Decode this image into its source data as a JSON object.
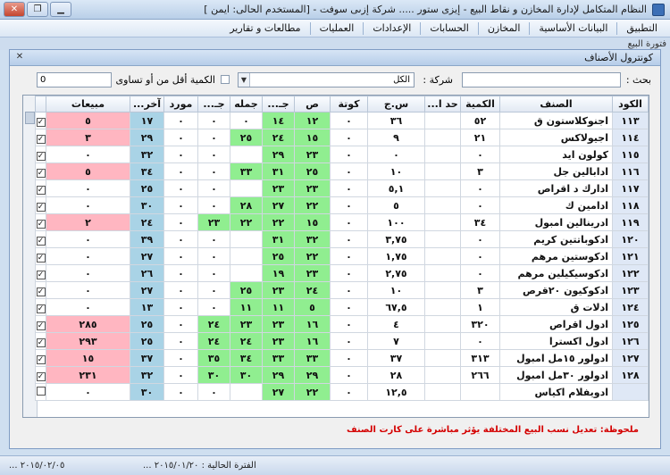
{
  "window": {
    "title": "النظام المتكامل لإدارة المخازن و نقاط البيع - إيزى ستور ..... شركة إزىى سوفت - [المستخدم الحالى: ايمن ]",
    "minimize": "▁",
    "maximize": "❐",
    "close": "✕"
  },
  "menu": [
    "التطبيق",
    "البيانات الأساسية",
    "المخازن",
    "الحسابات",
    "الإعدادات",
    "العمليات",
    "مطالعات و تقارير"
  ],
  "shortcut_strip": "فتورة البيع",
  "child_window": {
    "title": "كونترول الأصناف",
    "close": "✕"
  },
  "filter": {
    "search_label": "بحث :",
    "search_value": "",
    "company_label": "شركة :",
    "company_value": "الكل",
    "qty_label": "الكمية أقل من أو تساوى",
    "qty_value": "0"
  },
  "table": {
    "headers": [
      "الكود",
      "الصنف",
      "الكمية",
      "حد ا...",
      "س.ج",
      "كوتة",
      "ص",
      "جـ...",
      "جمله",
      "جـ...",
      "مورد",
      "آخر...",
      "مبيعات",
      ""
    ],
    "rows": [
      {
        "code": "١١٣",
        "name": "اجنوكلاستون ق",
        "qty": "٥٢",
        "limit": "",
        "price": "٣٦",
        "quota": "٠",
        "s": "١٢",
        "j1": "١٤",
        "bulk": "٠",
        "j2": "٠",
        "supplier": "٠",
        "last": "١٧",
        "sales": "٥",
        "sales_pink": true,
        "checked": true
      },
      {
        "code": "١١٤",
        "name": "اجيولاكس",
        "qty": "٢١",
        "limit": "",
        "price": "٩",
        "quota": "٠",
        "s": "١٥",
        "j1": "٢٤",
        "bulk": "٢٥",
        "j2": "٠",
        "supplier": "٠",
        "last": "٢٩",
        "sales": "٣",
        "sales_pink": true,
        "checked": true
      },
      {
        "code": "١١٥",
        "name": "كولون ايد",
        "qty": "٠",
        "limit": "",
        "price": "٠",
        "quota": "٠",
        "s": "٢٣",
        "j1": "٢٩",
        "bulk": "",
        "j2": "٠",
        "supplier": "٠",
        "last": "٣٢",
        "sales": "٠",
        "sales_pink": false,
        "checked": true
      },
      {
        "code": "١١٦",
        "name": "ادابالين جل",
        "qty": "٣",
        "limit": "",
        "price": "١٠",
        "quota": "٠",
        "s": "٢٥",
        "j1": "٣١",
        "bulk": "٣٣",
        "j2": "٠",
        "supplier": "٠",
        "last": "٣٤",
        "sales": "٥",
        "sales_pink": true,
        "checked": true
      },
      {
        "code": "١١٧",
        "name": "ادارك د اقراص",
        "qty": "٠",
        "limit": "",
        "price": "٥,١",
        "quota": "٠",
        "s": "٢٣",
        "j1": "٢٣",
        "bulk": "",
        "j2": "٠",
        "supplier": "٠",
        "last": "٢٥",
        "sales": "٠",
        "sales_pink": false,
        "checked": true
      },
      {
        "code": "١١٨",
        "name": "ادامين ك",
        "qty": "٠",
        "limit": "",
        "price": "٥",
        "quota": "٠",
        "s": "٢٢",
        "j1": "٢٧",
        "bulk": "٢٨",
        "j2": "٠",
        "supplier": "٠",
        "last": "٣٠",
        "sales": "٠",
        "sales_pink": false,
        "checked": true
      },
      {
        "code": "١١٩",
        "name": "ادرينالين امبول",
        "qty": "٣٤",
        "limit": "",
        "price": "١٠٠",
        "quota": "٠",
        "s": "١٥",
        "j1": "٢٢",
        "bulk": "٢٢",
        "j2": "٢٣",
        "supplier": "٠",
        "last": "٢٤",
        "sales": "٢",
        "sales_pink": true,
        "checked": true
      },
      {
        "code": "١٢٠",
        "name": "ادكوباتتين كريم",
        "qty": "٠",
        "limit": "",
        "price": "٣,٧٥",
        "quota": "٠",
        "s": "٣٢",
        "j1": "٣١",
        "bulk": "",
        "j2": "٠",
        "supplier": "٠",
        "last": "٣٩",
        "sales": "٠",
        "sales_pink": false,
        "checked": true
      },
      {
        "code": "١٢١",
        "name": "ادكوستين مرهم",
        "qty": "٠",
        "limit": "",
        "price": "١,٧٥",
        "quota": "٠",
        "s": "٢٢",
        "j1": "٢٥",
        "bulk": "",
        "j2": "٠",
        "supplier": "٠",
        "last": "٢٧",
        "sales": "٠",
        "sales_pink": false,
        "checked": true
      },
      {
        "code": "١٢٢",
        "name": "ادكوسيكيلين مرهم",
        "qty": "٠",
        "limit": "",
        "price": "٢,٧٥",
        "quota": "٠",
        "s": "٢٣",
        "j1": "١٩",
        "bulk": "",
        "j2": "٠",
        "supplier": "٠",
        "last": "٢٦",
        "sales": "٠",
        "sales_pink": false,
        "checked": true
      },
      {
        "code": "١٢٣",
        "name": "ادكوكيون ٢٠قرص",
        "qty": "٣",
        "limit": "",
        "price": "١٠",
        "quota": "٠",
        "s": "٢٤",
        "j1": "٢٣",
        "bulk": "٢٥",
        "j2": "٠",
        "supplier": "٠",
        "last": "٢٧",
        "sales": "٠",
        "sales_pink": false,
        "checked": true
      },
      {
        "code": "١٢٤",
        "name": "ادلات ق",
        "qty": "١",
        "limit": "",
        "price": "٦٧,٥",
        "quota": "٠",
        "s": "٥",
        "j1": "١١",
        "bulk": "١١",
        "j2": "٠",
        "supplier": "٠",
        "last": "١٣",
        "sales": "٠",
        "sales_pink": false,
        "checked": true
      },
      {
        "code": "١٢٥",
        "name": "ادول اقراص",
        "qty": "٣٢٠",
        "limit": "",
        "price": "٤",
        "quota": "٠",
        "s": "١٦",
        "j1": "٢٣",
        "bulk": "٢٣",
        "j2": "٢٤",
        "supplier": "٠",
        "last": "٢٥",
        "sales": "٢٨٥",
        "sales_pink": true,
        "checked": true
      },
      {
        "code": "١٢٦",
        "name": "ادول اكسترا",
        "qty": "٠",
        "limit": "",
        "price": "٧",
        "quota": "٠",
        "s": "١٦",
        "j1": "٢٣",
        "bulk": "٢٤",
        "j2": "٢٤",
        "supplier": "٠",
        "last": "٢٥",
        "sales": "٢٩٣",
        "sales_pink": true,
        "checked": true
      },
      {
        "code": "١٢٧",
        "name": "ادولور ١٥مل امبول",
        "qty": "٣١٣",
        "limit": "",
        "price": "٣٧",
        "quota": "٠",
        "s": "٣٣",
        "j1": "٣٣",
        "bulk": "٣٤",
        "j2": "٣٥",
        "supplier": "٠",
        "last": "٣٧",
        "sales": "١٥",
        "sales_pink": true,
        "checked": true
      },
      {
        "code": "١٢٨",
        "name": "ادولور ٣٠مل امبول",
        "qty": "٢٦٦",
        "limit": "",
        "price": "٢٨",
        "quota": "٠",
        "s": "٢٩",
        "j1": "٢٩",
        "bulk": "٣٠",
        "j2": "٣٠",
        "supplier": "٠",
        "last": "٣٢",
        "sales": "٢٣١",
        "sales_pink": true,
        "checked": true
      },
      {
        "code": "",
        "name": "ادويفلام اكياس",
        "qty": "",
        "limit": "",
        "price": "١٢,٥",
        "quota": "٠",
        "s": "٢٢",
        "j1": "٢٧",
        "bulk": "",
        "j2": "٠",
        "supplier": "٠",
        "last": "٣٠",
        "sales": "٠",
        "sales_pink": false,
        "checked": false
      }
    ]
  },
  "note": "ملحوظة: تعديل نسب البيع المختلفة يؤثر مباشرة على كارت الصنف",
  "status": {
    "period": "الفترة الحالية : ٢٠١٥/٠١/٢٠ ...",
    "date": "٢٠١٥/٠٢/٠٥ ..."
  }
}
